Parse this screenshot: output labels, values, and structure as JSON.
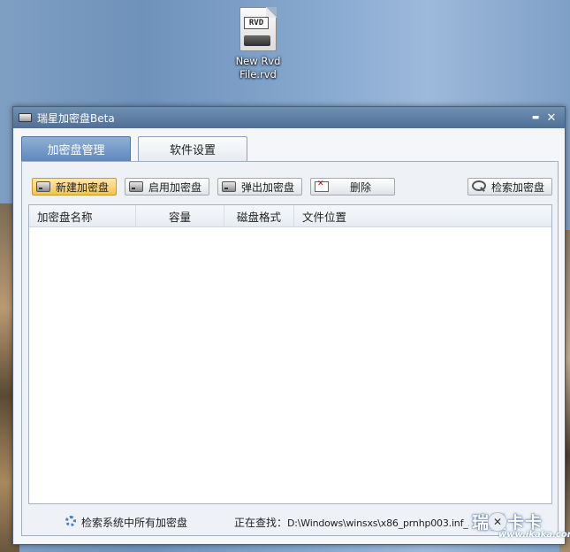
{
  "desktop": {
    "icon_badge": "RVD",
    "icon_label_line1": "New Rvd",
    "icon_label_line2": "File.rvd"
  },
  "window": {
    "title": "瑞星加密盘Beta",
    "minimize": "▬",
    "close": "✕"
  },
  "tabs": [
    {
      "label": "加密盘管理",
      "active": true
    },
    {
      "label": "软件设置",
      "active": false
    }
  ],
  "toolbar": {
    "new_disk": "新建加密盘",
    "enable_disk": "启用加密盘",
    "eject_disk": "弹出加密盘",
    "delete": "删除",
    "search_disk": "检索加密盘"
  },
  "table": {
    "columns": [
      "加密盘名称",
      "容量",
      "磁盘格式",
      "文件位置"
    ],
    "rows": []
  },
  "status": {
    "searching_label": "检索系统中所有加密盘",
    "current_prefix": "正在查找：",
    "current_path": "D:\\Windows\\winsxs\\x86_prnhp003.inf_..."
  },
  "watermark": {
    "brand": "瑞星卡卡",
    "url": "www.ikaka.com",
    "close": "✕"
  },
  "colors": {
    "titlebar": "#5a7aa0",
    "active_tab": "#6f96c6",
    "primary_button": "#f7c24d"
  }
}
